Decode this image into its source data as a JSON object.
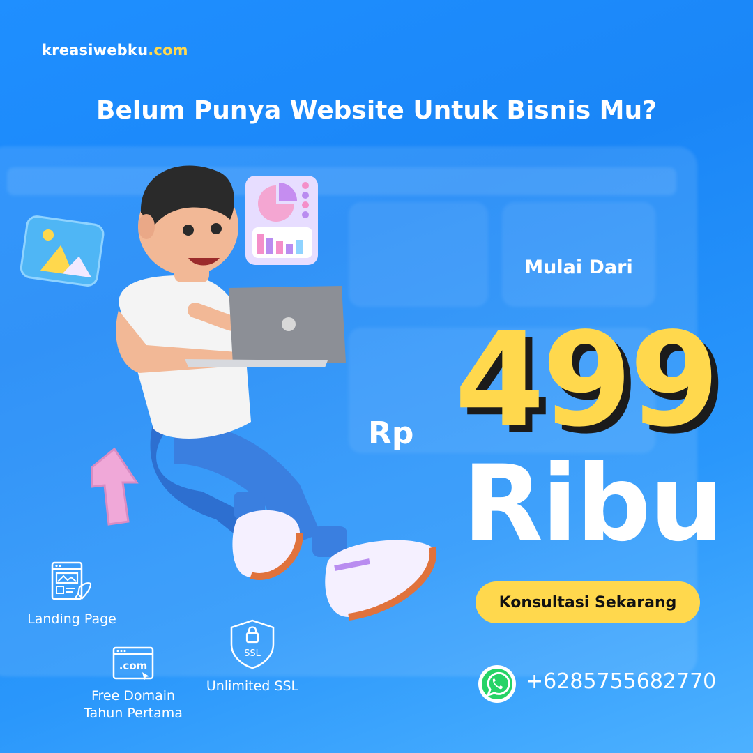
{
  "brand": {
    "name": "kreasiwebku",
    "tld": ".com"
  },
  "headline": "Belum Punya Website Untuk Bisnis Mu?",
  "pricing": {
    "intro": "Mulai Dari",
    "currency": "Rp",
    "amount": "499",
    "unit": "Ribu"
  },
  "cta": {
    "label": "Konsultasi Sekarang"
  },
  "contact": {
    "icon": "whatsapp-icon",
    "phone": "+6285755682770"
  },
  "features": [
    {
      "icon": "landing-page-icon",
      "label": "Landing Page"
    },
    {
      "icon": "domain-com-icon",
      "label_line1": "Free Domain",
      "label_line2": "Tahun Pertama"
    },
    {
      "icon": "ssl-shield-icon",
      "label": "Unlimited SSL",
      "badge": "SSL"
    }
  ],
  "domain_icon_text": ".com",
  "colors": {
    "background": "#1f8fff",
    "accent": "#ffd84d",
    "text": "#ffffff",
    "whatsapp": "#25d366"
  }
}
